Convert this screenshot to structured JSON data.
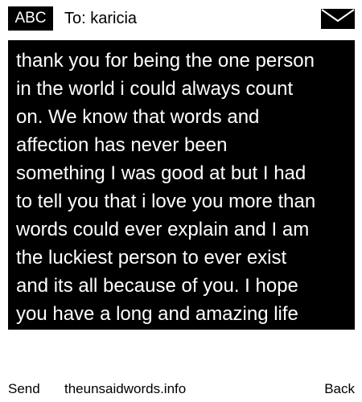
{
  "header": {
    "input_mode": "ABC",
    "recipient": "To: karicia",
    "icon": "envelope-icon"
  },
  "message": {
    "lines": [
      "thank you for being the one person",
      "in the world i could always count",
      "on. We know that words and",
      "affection has never been",
      "something I was good at but I had",
      "to tell you that i love you more than",
      "words could ever explain and I am",
      "the luckiest person to ever exist",
      "and its all because of you. I hope",
      "you have a long and amazing life"
    ]
  },
  "softkeys": {
    "left": "Send",
    "center": "theunsaidwords.info",
    "right": "Back"
  },
  "colors": {
    "background": "#ffffff",
    "message_background": "#000000",
    "message_text": "#ffffff",
    "text": "#000000"
  }
}
